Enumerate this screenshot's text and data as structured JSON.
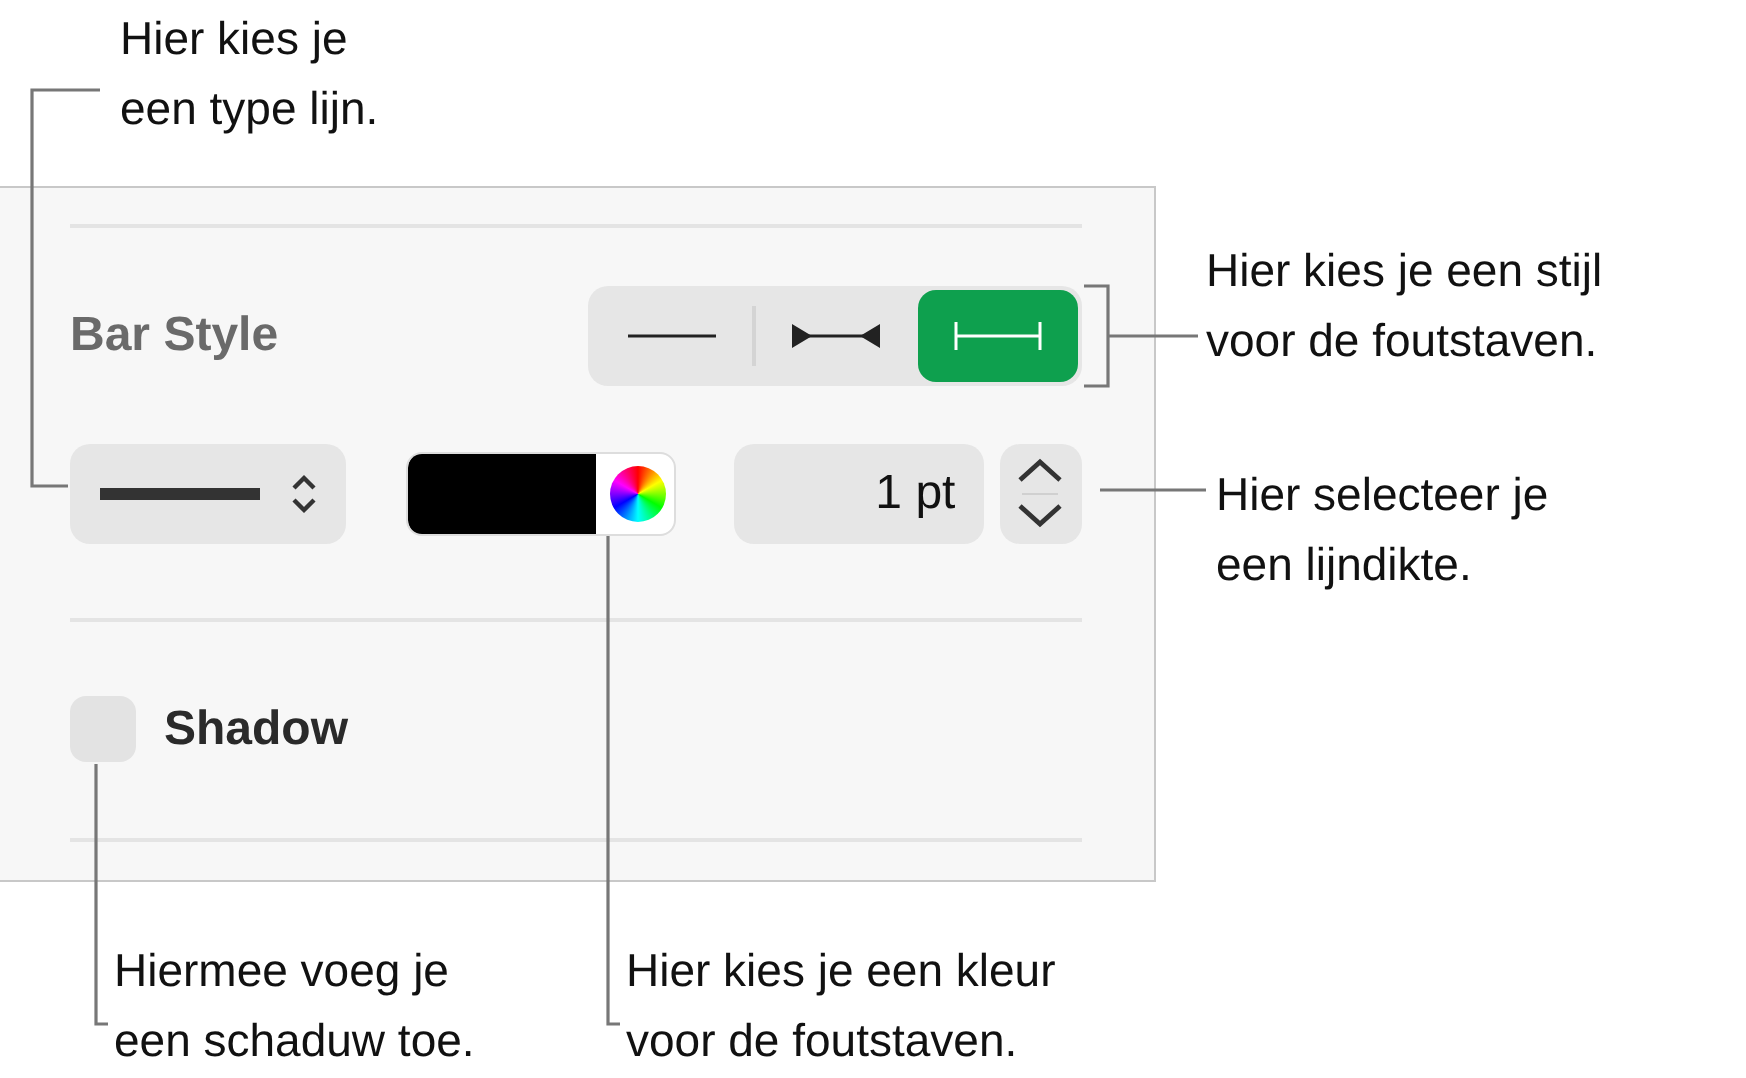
{
  "panel": {
    "bar_style": {
      "label": "Bar Style",
      "segments": [
        {
          "kind": "plain",
          "selected": false
        },
        {
          "kind": "arrows",
          "selected": false
        },
        {
          "kind": "caps",
          "selected": true
        }
      ]
    },
    "line_width": {
      "value": "1 pt"
    },
    "shadow": {
      "label": "Shadow",
      "checked": false
    }
  },
  "callouts": [
    {
      "lines": [
        "Hier kies je",
        "een type lijn."
      ]
    },
    {
      "lines": [
        "Hier kies je een stijl",
        "voor de foutstaven."
      ]
    },
    {
      "lines": [
        "Hier selecteer je",
        "een lijndikte."
      ]
    },
    {
      "lines": [
        "Hiermee voeg je",
        "een schaduw toe."
      ]
    },
    {
      "lines": [
        "Hier kies je een kleur",
        "voor de foutstaven."
      ]
    }
  ]
}
